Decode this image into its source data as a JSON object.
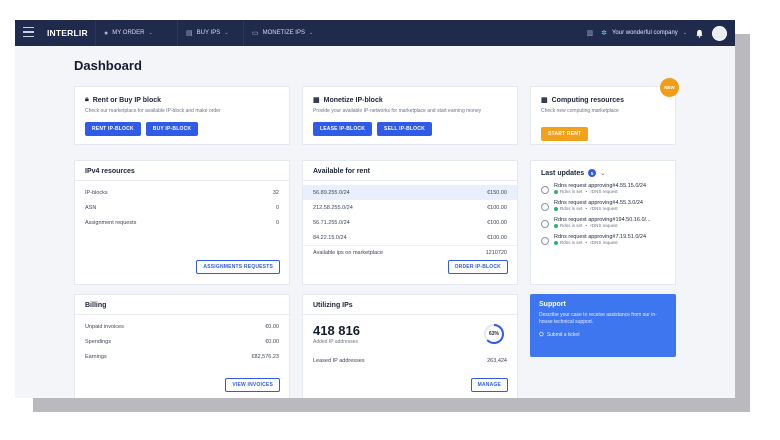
{
  "topbar": {
    "logo": "INTERLIR",
    "nav": [
      {
        "label": "MY ORDER",
        "icon": "order-icon"
      },
      {
        "label": "BUY IPS",
        "icon": "cart-icon"
      },
      {
        "label": "MONETIZE IPS",
        "icon": "monetize-icon"
      }
    ],
    "company": "Your wonderful company"
  },
  "page_title": "Dashboard",
  "rent_card": {
    "title": "Rent or Buy IP block",
    "desc": "Check our marketplace for available IP-block and make order",
    "btn_rent": "RENT IP-BLOCK",
    "btn_buy": "BUY IP-BLOCK"
  },
  "monetize_card": {
    "title": "Monetize IP-block",
    "desc": "Provide your available IP-networks for marketplace and start earning money",
    "btn_lease": "LEASE IP-BLOCK",
    "btn_sell": "SELL IP-BLOCK"
  },
  "computing_card": {
    "title": "Computing resources",
    "desc": "Check new computing marketplace",
    "btn_start": "START RENT",
    "badge": "NEW"
  },
  "ipv4": {
    "title": "IPv4 resources",
    "rows": [
      {
        "label": "IP-blocks",
        "value": "32"
      },
      {
        "label": "ASN",
        "value": "0"
      },
      {
        "label": "Assignment requests",
        "value": "0"
      }
    ],
    "button": "ASSIGNMENTS REQUESTS"
  },
  "available": {
    "title": "Available for rent",
    "rows": [
      {
        "ip": "56.89.255.0/24",
        "price": "€150.00"
      },
      {
        "ip": "212.58.255.0/24",
        "price": "€100.00"
      },
      {
        "ip": "56.71.255.0/24",
        "price": "€100.00"
      },
      {
        "ip": "84.22.15.0/24",
        "price": "€100.00"
      }
    ],
    "total_label": "Available ips on marketplace",
    "total_value": "1210720",
    "button": "ORDER IP-BLOCK"
  },
  "updates": {
    "title": "Last updates",
    "count": "5",
    "items": [
      {
        "title": "Rdns request approving#4.55.15.0/24",
        "status": "Rdns is set",
        "type": "rDNS request"
      },
      {
        "title": "Rdns request approving#4.55.3.0/24",
        "status": "Rdns is set",
        "type": "rDNS request"
      },
      {
        "title": "Rdns request approving#194.50.16.0/...",
        "status": "Rdns is set",
        "type": "rDNS request"
      },
      {
        "title": "Rdns request approving#7.19.51.0/24",
        "status": "Rdns is set",
        "type": "rDNS request"
      }
    ]
  },
  "billing": {
    "title": "Billing",
    "rows": [
      {
        "label": "Unpaid invoices",
        "value": "€0.00"
      },
      {
        "label": "Spendings",
        "value": "€0.00"
      },
      {
        "label": "Earnings",
        "value": "€82,576.23"
      }
    ],
    "button": "VIEW INVOICES"
  },
  "utilizing": {
    "title": "Utilizing IPs",
    "big_number": "418 816",
    "big_label": "Added IP addresses",
    "gauge_label": "63%",
    "gauge_fraction": 0.63,
    "leased_label": "Leased IP addresses",
    "leased_value": "263,424",
    "button": "MANAGE"
  },
  "support": {
    "title": "Support",
    "text": "Describe your case to receive assistance from our in-house technical support.",
    "link": "Submit a ticket"
  },
  "colors": {
    "topbar": "#1f2a4c",
    "accent": "#2f5be7",
    "orange": "#f2a21a",
    "support": "#3e76f0",
    "success": "#2db36b"
  }
}
